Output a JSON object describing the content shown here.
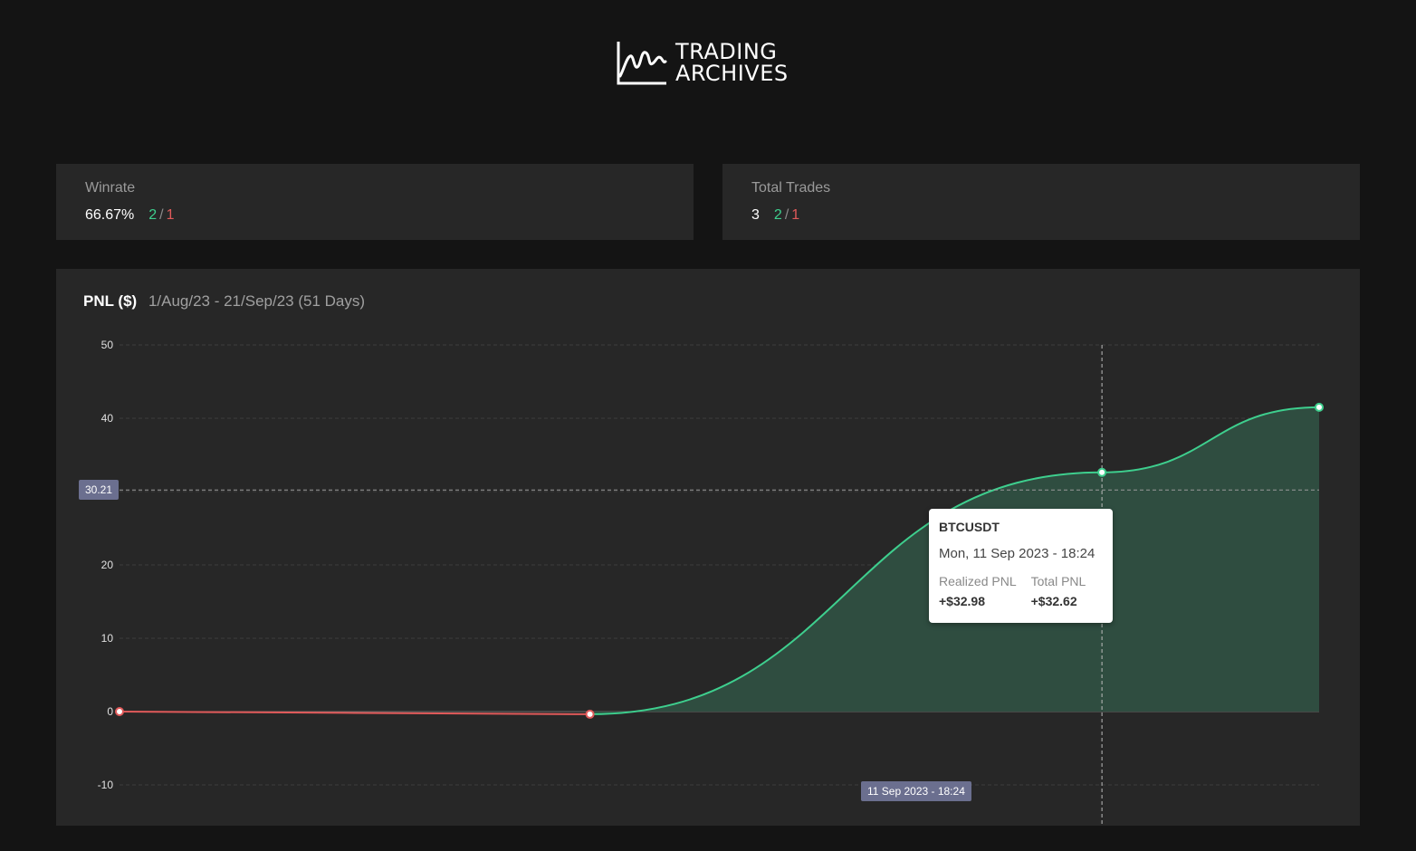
{
  "app": {
    "logo_line1": "TRADING",
    "logo_line2": "ARCHIVES"
  },
  "stats": {
    "winrate": {
      "label": "Winrate",
      "value": "66.67%",
      "wins": "2",
      "separator": "/",
      "losses": "1"
    },
    "total_trades": {
      "label": "Total Trades",
      "value": "3",
      "wins": "2",
      "separator": "/",
      "losses": "1"
    }
  },
  "pnl": {
    "title": "PNL ($)",
    "range": "1/Aug/23 - 21/Sep/23 (51 Days)",
    "crosshair_y_label": "30.21",
    "crosshair_x_label": "11 Sep 2023 - 18:24",
    "tooltip": {
      "symbol": "BTCUSDT",
      "date": "Mon, 11 Sep 2023 - 18:24",
      "realized_label": "Realized PNL",
      "realized_value": "+$32.98",
      "total_label": "Total PNL",
      "total_value": "+$32.62"
    }
  },
  "colors": {
    "background": "#141414",
    "card": "#272727",
    "profit": "#3ecf8e",
    "loss": "#e05a5a",
    "profit_fill": "#2f4d40",
    "badge": "#6b6f8f"
  },
  "chart_data": {
    "type": "area",
    "title": "PNL ($)",
    "ylim": [
      -10,
      50
    ],
    "y_ticks": [
      -10,
      0,
      10,
      20,
      30,
      40,
      50
    ],
    "y_tick_labels": [
      "-10",
      "0",
      "10",
      "20",
      "",
      "40",
      "50"
    ],
    "grid": true,
    "series": [
      {
        "points": [
          {
            "x": "2023-08-01",
            "y": 0
          },
          {
            "x": "2023-08-21",
            "y": -0.36
          },
          {
            "x": "2023-09-11 18:24",
            "y": 32.62
          },
          {
            "x": "2023-09-21",
            "y": 41.5
          }
        ]
      }
    ]
  }
}
